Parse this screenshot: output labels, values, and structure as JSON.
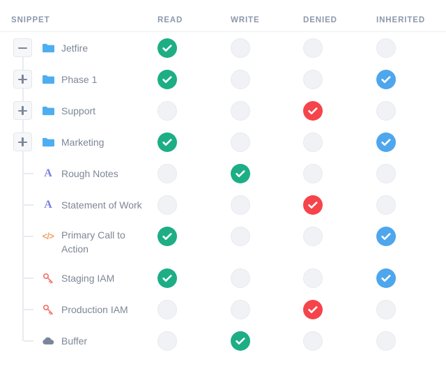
{
  "table": {
    "columns": [
      {
        "key": "snippet",
        "label": "SNIPPET"
      },
      {
        "key": "read",
        "label": "READ"
      },
      {
        "key": "write",
        "label": "WRITE"
      },
      {
        "key": "denied",
        "label": "DENIED"
      },
      {
        "key": "inherited",
        "label": "INHERITED"
      }
    ]
  },
  "colors": {
    "granted_green": "#1dae86",
    "inherited_blue": "#4ea6ed",
    "denied_red": "#f5444a",
    "empty_gray": "#f0f2f6",
    "folder_blue": "#4eaef0",
    "text_icon_purple": "#7b7fe0",
    "code_icon_orange": "#f0a060",
    "key_icon_red": "#f4736a",
    "cloud_icon_gray": "#7b869c",
    "header_text": "#8d98ab",
    "label_text": "#7e8796"
  },
  "rows": [
    {
      "label": "Jetfire",
      "icon": "folder-icon",
      "depth": 0,
      "toggle": "minus",
      "toggle_state": "expanded",
      "read": "granted",
      "write": "empty",
      "denied": "empty",
      "inherited": "empty"
    },
    {
      "label": "Phase 1",
      "icon": "folder-icon",
      "depth": 0,
      "toggle": "plus",
      "toggle_state": "collapsed",
      "read": "granted",
      "write": "empty",
      "denied": "empty",
      "inherited": "inherited"
    },
    {
      "label": "Support",
      "icon": "folder-icon",
      "depth": 0,
      "toggle": "plus",
      "toggle_state": "collapsed",
      "read": "empty",
      "write": "empty",
      "denied": "denied",
      "inherited": "empty"
    },
    {
      "label": "Marketing",
      "icon": "folder-icon",
      "depth": 0,
      "toggle": "plus",
      "toggle_state": "collapsed",
      "read": "granted",
      "write": "empty",
      "denied": "empty",
      "inherited": "inherited"
    },
    {
      "label": "Rough Notes",
      "icon": "text-snippet-icon",
      "depth": 1,
      "toggle": "none",
      "toggle_state": "none",
      "read": "empty",
      "write": "granted",
      "denied": "empty",
      "inherited": "empty"
    },
    {
      "label": "Statement of Work",
      "icon": "text-snippet-icon",
      "depth": 1,
      "toggle": "none",
      "toggle_state": "none",
      "read": "empty",
      "write": "empty",
      "denied": "denied",
      "inherited": "empty"
    },
    {
      "label": "Primary Call to Action",
      "icon": "code-snippet-icon",
      "depth": 1,
      "toggle": "none",
      "toggle_state": "none",
      "read": "granted",
      "write": "empty",
      "denied": "empty",
      "inherited": "inherited"
    },
    {
      "label": "Staging IAM",
      "icon": "key-icon",
      "depth": 1,
      "toggle": "none",
      "toggle_state": "none",
      "read": "granted",
      "write": "empty",
      "denied": "empty",
      "inherited": "inherited"
    },
    {
      "label": "Production IAM",
      "icon": "key-icon",
      "depth": 1,
      "toggle": "none",
      "toggle_state": "none",
      "read": "empty",
      "write": "empty",
      "denied": "denied",
      "inherited": "empty"
    },
    {
      "label": "Buffer",
      "icon": "cloud-icon",
      "depth": 1,
      "toggle": "none",
      "toggle_state": "none",
      "read": "empty",
      "write": "granted",
      "denied": "empty",
      "inherited": "empty"
    }
  ]
}
